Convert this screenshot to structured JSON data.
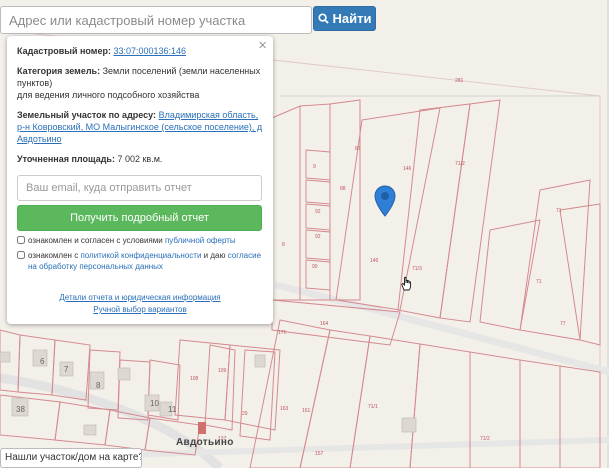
{
  "search": {
    "placeholder": "Адрес или кадастровый номер участка",
    "button_label": "Найти",
    "button_icon": "search-icon"
  },
  "popup": {
    "close_glyph": "×",
    "cadastral_label": "Кадастровый номер:",
    "cadastral_number": "33:07:000136:146",
    "category_label": "Категория земель:",
    "category_value": "Земли поселений (земли населенных пунктов)",
    "use_value": "для ведения личного подсобного хозяйства",
    "address_label": "Земельный участок по адресу:",
    "address_value": "Владимирская область, р-н Ковровский, МО Малыгинское (сельское поселение), д Авдотьино",
    "area_label": "Уточненная площадь:",
    "area_value": "7 002 кв.м.",
    "email_placeholder": "Ваш email, куда отправить отчет",
    "report_button": "Получить подробный отчет",
    "consent1_text": "ознакомлен и согласен с условиями",
    "consent1_link": "публичной оферты",
    "consent2_text": "ознакомлен с",
    "consent2_link1": "политикой конфиденциальности",
    "consent2_mid": "и даю",
    "consent2_link2": "согласие на обработку персональных данных",
    "details_link": "Детали отчета и юридическая информация",
    "manual_link": "Ручной выбор вариантов"
  },
  "map": {
    "town_label": "Авдотьино",
    "found_button": "Нашли участок/дом на карте?",
    "marker_color": "#2f7fd6",
    "parcel_stroke": "#d8868c",
    "house_labels": [
      "6",
      "7",
      "8",
      "10",
      "11",
      "38"
    ]
  }
}
